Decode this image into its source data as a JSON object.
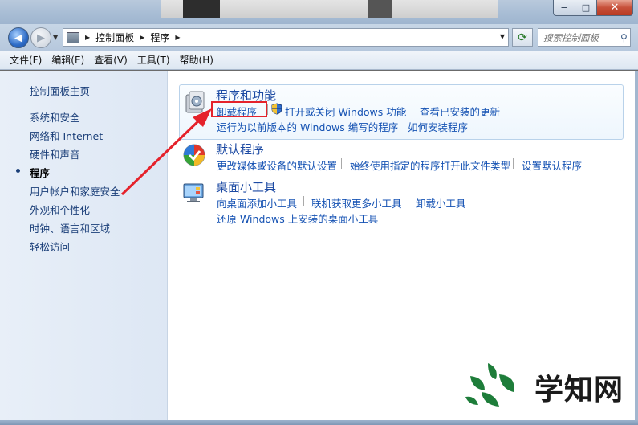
{
  "window": {
    "caption_buttons": {
      "minimize": "−",
      "maximize": "□",
      "close": "✕"
    }
  },
  "address_bar": {
    "crumbs": [
      "控制面板",
      "程序"
    ],
    "search_placeholder": "搜索控制面板"
  },
  "menu": {
    "items": [
      "文件(F)",
      "编辑(E)",
      "查看(V)",
      "工具(T)",
      "帮助(H)"
    ]
  },
  "sidebar": {
    "items": [
      {
        "label": "控制面板主页",
        "current": false
      },
      {
        "label": "系统和安全",
        "current": false
      },
      {
        "label": "网络和 Internet",
        "current": false
      },
      {
        "label": "硬件和声音",
        "current": false
      },
      {
        "label": "程序",
        "current": true
      },
      {
        "label": "用户帐户和家庭安全",
        "current": false
      },
      {
        "label": "外观和个性化",
        "current": false
      },
      {
        "label": "时钟、语言和区域",
        "current": false
      },
      {
        "label": "轻松访问",
        "current": false
      }
    ]
  },
  "sections": {
    "programs": {
      "title": "程序和功能",
      "links": [
        "卸载程序",
        "打开或关闭 Windows 功能",
        "查看已安装的更新",
        "运行为以前版本的 Windows 编写的程序",
        "如何安装程序"
      ]
    },
    "defaults": {
      "title": "默认程序",
      "links": [
        "更改媒体或设备的默认设置",
        "始终使用指定的程序打开此文件类型",
        "设置默认程序"
      ]
    },
    "gadgets": {
      "title": "桌面小工具",
      "links": [
        "向桌面添加小工具",
        "联机获取更多小工具",
        "卸载小工具",
        "还原 Windows 上安装的桌面小工具"
      ]
    }
  },
  "annotation": {
    "color": "#e5222b"
  },
  "watermark": {
    "text": "学知网",
    "leaf_color": "#1e7d3a"
  },
  "colors": {
    "link": "#1552b3",
    "title": "#1c4aa3",
    "sidebar_link": "#1a3e78"
  }
}
